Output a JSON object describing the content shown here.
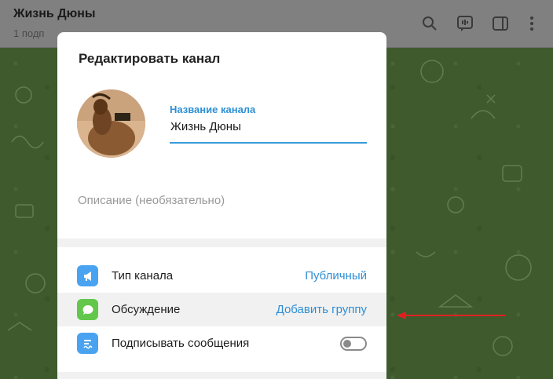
{
  "window": {
    "title": "Жизнь Дюны",
    "subtitle": "1 подп"
  },
  "dialog": {
    "title": "Редактировать канал",
    "name_label": "Название канала",
    "name_value": "Жизнь Дюны",
    "description_placeholder": "Описание (необязательно)"
  },
  "settings": [
    {
      "label": "Тип канала",
      "value": "Публичный",
      "icon": "megaphone-icon",
      "color": "#4aa3f0"
    },
    {
      "label": "Обсуждение",
      "value": "Добавить группу",
      "icon": "chat-bubble-icon",
      "color": "#62c74a"
    },
    {
      "label": "Подписывать сообщения",
      "icon": "signature-icon",
      "color": "#4aa3f0",
      "toggle": false
    }
  ],
  "colors": {
    "accent": "#2f8ed6",
    "overlay": "#808080",
    "arrow": "#e02020"
  }
}
